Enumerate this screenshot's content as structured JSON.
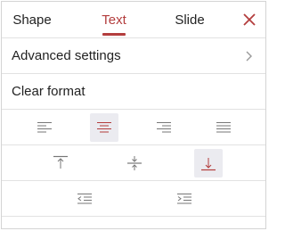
{
  "tabs": {
    "shape": "Shape",
    "text": "Text",
    "slide": "Slide"
  },
  "rows": {
    "advanced_settings": "Advanced settings",
    "clear_format": "Clear format"
  },
  "horizontal_alignment": {
    "options": [
      "left",
      "center",
      "right",
      "justify"
    ],
    "selected": "center"
  },
  "vertical_alignment": {
    "options": [
      "top",
      "middle",
      "bottom"
    ],
    "selected": "bottom"
  },
  "indent": {
    "options": [
      "decrease-indent",
      "increase-indent"
    ]
  },
  "colors": {
    "accent": "#b33d3d",
    "icon": "#777777",
    "selected_bg": "#ebebf0",
    "divider": "#e2e2e2"
  }
}
